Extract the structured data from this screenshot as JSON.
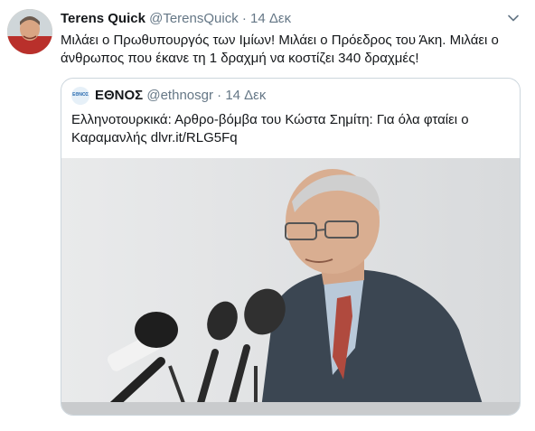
{
  "tweet": {
    "display_name": "Terens Quick",
    "handle": "@TerensQuick",
    "separator": "·",
    "date": "14 Δεκ",
    "text": "Μιλάει ο Πρωθυπουργός των Ιμίων! Μιλάει ο Πρόεδρος του Άκη. Μιλάει ο άνθρωπος που έκανε τη 1 δραχμή να κοστίζει 340 δραχμές!",
    "avatar_icon": "user-avatar"
  },
  "quoted": {
    "logo_text": "ΕΘΝΟΣ",
    "display_name": "ΕΘΝΟΣ",
    "handle": "@ethnosgr",
    "separator": "·",
    "date": "14 Δεκ",
    "text": "Ελληνοτουρκικά: Αρθρο-βόμβα του Κώστα Σημίτη: Για όλα φταίει ο Καραμανλής dlvr.it/RLG5Fq",
    "photo_icon": "speaker-at-podium-photo"
  },
  "colors": {
    "name": "#14171a",
    "secondary": "#657786",
    "border": "#ccd6dd",
    "link": "#1b95e0"
  }
}
